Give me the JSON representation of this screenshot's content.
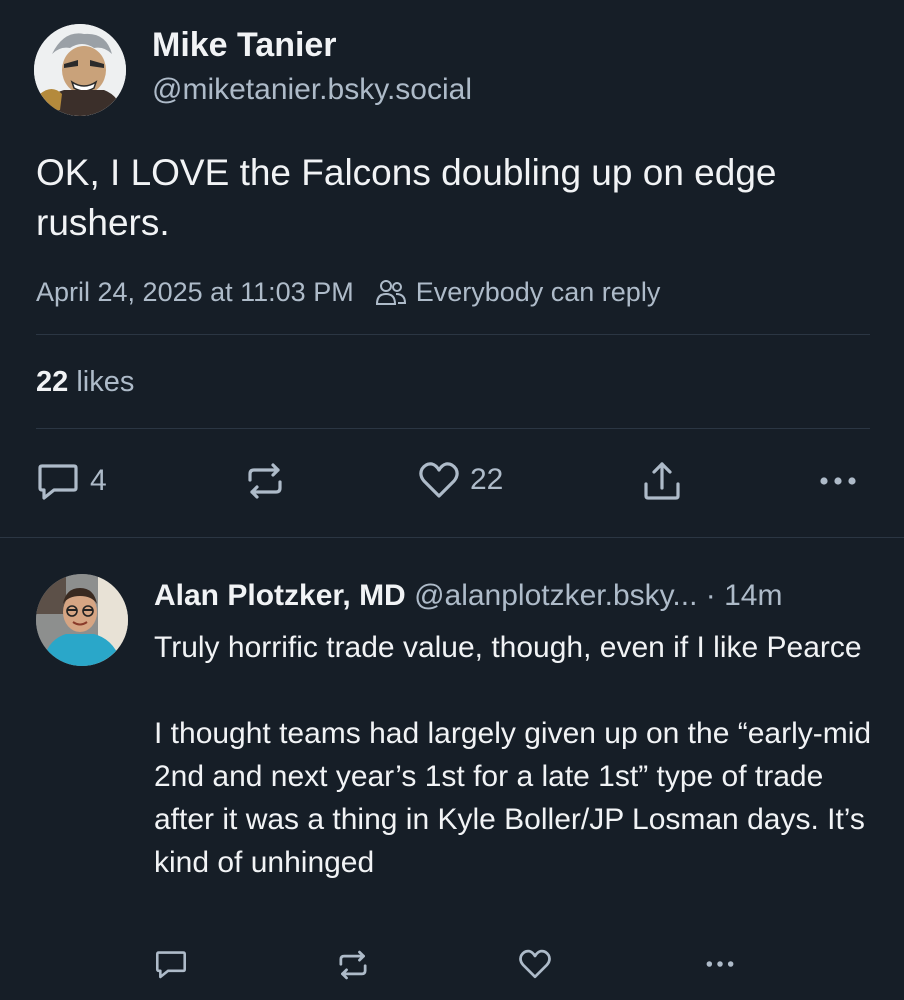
{
  "post": {
    "author_name": "Mike Tanier",
    "author_handle": "@miketanier.bsky.social",
    "text": "OK, I LOVE the Falcons doubling up on edge rushers.",
    "timestamp": "April 24, 2025 at 11:03 PM",
    "reply_setting": "Everybody can reply",
    "likes_count": "22",
    "likes_label": "likes",
    "actions": {
      "reply_count": "4",
      "like_count": "22"
    }
  },
  "reply": {
    "author_name": "Alan Plotzker, MD",
    "author_handle": "@alanplotzker.bsky...",
    "time": "· 14m",
    "paragraphs": [
      "Truly horrific trade value, though, even if I like Pearce",
      "I thought teams had largely given up on the “early-mid 2nd and next year’s 1st for a late 1st” type of trade after it was a thing in Kyle Boller/JP Losman days. It’s kind of unhinged"
    ]
  },
  "icons": {
    "people": "people-icon",
    "reply": "reply-icon",
    "repost": "repost-icon",
    "like": "heart-icon",
    "share": "share-icon",
    "more": "more-icon"
  },
  "colors": {
    "background": "#161e27",
    "text_primary": "#f1f3f5",
    "text_secondary": "#aebbc9",
    "divider": "#2b3643"
  }
}
